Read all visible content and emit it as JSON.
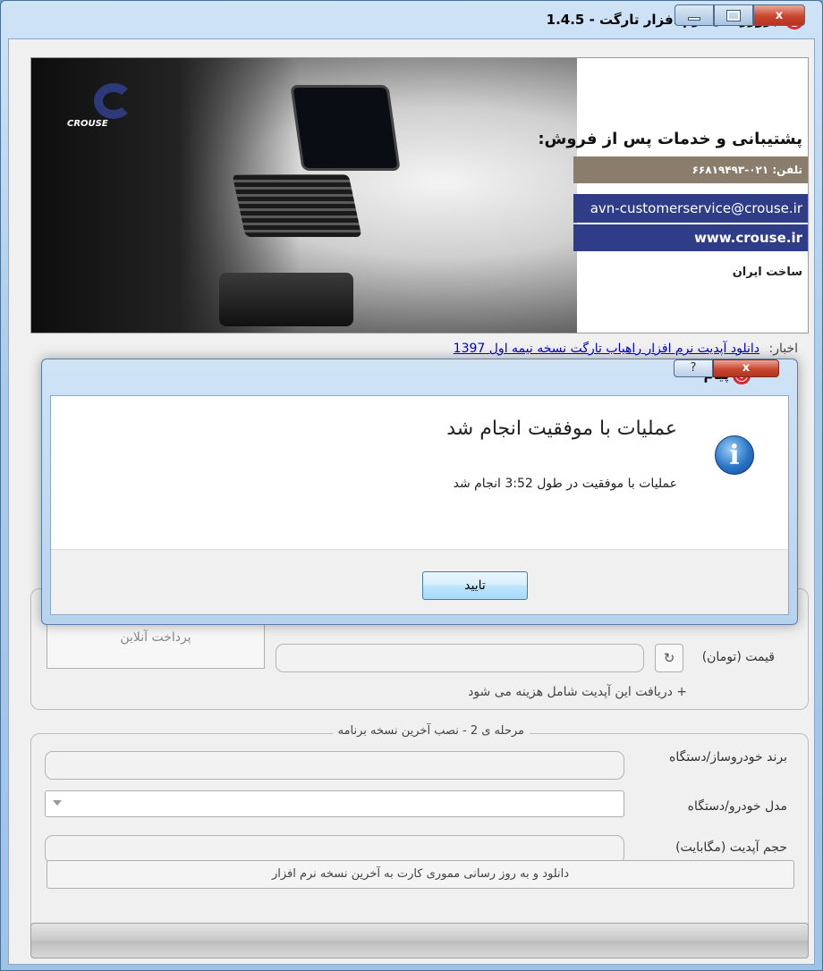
{
  "window": {
    "title": "بروزرسان نرم افزار تارگت - 1.4.5",
    "caption_min": "minimize",
    "caption_max": "maximize",
    "caption_close": "x"
  },
  "banner": {
    "brand_text": "CROUSE",
    "support_title": "پشتیبانی و خدمات پس از فروش:",
    "phone": "تلفن: ۰۲۱-۶۶۸۱۹۴۹۳",
    "email": "avn-customerservice@crouse.ir",
    "website": "www.crouse.ir",
    "made_in": "ساخت ایران"
  },
  "news": {
    "label": "اخبار:",
    "link": "دانلود آپدیت نرم افزار راهیاب تارگت نسخه نیمه اول 1397"
  },
  "payment": {
    "pay_button": "پرداخت آنلاین",
    "price_label": "قیمت (تومان)",
    "refresh_glyph": "↻",
    "note": "+ دریافت این آپدیت شامل هزینه می شود"
  },
  "step2": {
    "legend": "مرحله ی 2 - نصب آخرین نسخه برنامه",
    "brand_label": "برند خودروساز/دستگاه",
    "model_label": "مدل خودرو/دستگاه",
    "size_label": "حجم آپدیت (مگابایت)",
    "download_button": "دانلود و به روز رسانی مموری کارت به آخرین نسخه نرم افزار"
  },
  "progress": {
    "value": 0
  },
  "dialog": {
    "title": "پیام",
    "help_glyph": "?",
    "close_glyph": "x",
    "heading": "عملیات با موفقیت انجام شد",
    "message": "عملیات با موفقیت در طول 3:52 انجام شد",
    "ok_button": "تایید",
    "icon_glyph": "i"
  },
  "colors": {
    "brand_red": "#e0242c",
    "banner_blue": "#2f3d89",
    "banner_brown": "#8b7d6b",
    "link": "#0000cc"
  }
}
